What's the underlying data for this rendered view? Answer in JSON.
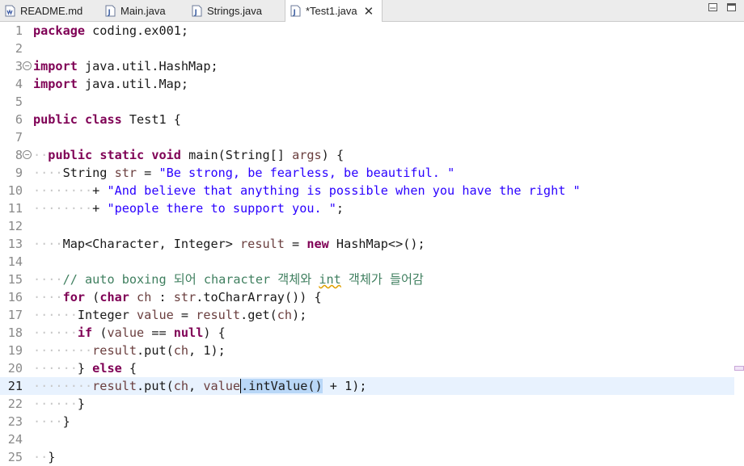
{
  "tabs": [
    {
      "label": "README.md",
      "icon": "markdown-file-icon",
      "active": false
    },
    {
      "label": "Main.java",
      "icon": "java-file-icon",
      "active": false
    },
    {
      "label": "Strings.java",
      "icon": "java-file-icon",
      "active": false
    },
    {
      "label": "*Test1.java",
      "icon": "java-file-icon",
      "active": true
    }
  ],
  "window_controls": [
    "minimize-icon",
    "maximize-icon"
  ],
  "editor": {
    "current_line": 21,
    "lines": [
      {
        "n": "1"
      },
      {
        "n": "2"
      },
      {
        "n": "3"
      },
      {
        "n": "4"
      },
      {
        "n": "5"
      },
      {
        "n": "6"
      },
      {
        "n": "7"
      },
      {
        "n": "8"
      },
      {
        "n": "9"
      },
      {
        "n": "10"
      },
      {
        "n": "11"
      },
      {
        "n": "12"
      },
      {
        "n": "13"
      },
      {
        "n": "14"
      },
      {
        "n": "15"
      },
      {
        "n": "16"
      },
      {
        "n": "17"
      },
      {
        "n": "18"
      },
      {
        "n": "19"
      },
      {
        "n": "20"
      },
      {
        "n": "21"
      },
      {
        "n": "22"
      },
      {
        "n": "23"
      },
      {
        "n": "24"
      },
      {
        "n": "25"
      }
    ],
    "t": {
      "l1a": "package",
      "l1b": " coding.ex001;",
      "l3a": "import",
      "l3b": " java.util.HashMap;",
      "l4a": "import",
      "l4b": " java.util.Map;",
      "l6a": "public",
      "l6b": "class",
      "l6c": " Test1 {",
      "l8a": "public",
      "l8b": "static",
      "l8c": "void",
      "l8d": " main(String[] ",
      "l8e": "args",
      "l8f": ") {",
      "l9a": "String ",
      "l9b": "str",
      "l9c": " = ",
      "l9d": "\"Be strong, be fearless, be beautiful. \"",
      "l10a": "+ ",
      "l10b": "\"And believe that anything is possible when you have the right \"",
      "l11a": "+ ",
      "l11b": "\"people there to support you. \"",
      "l11c": ";",
      "l13a": "Map<Character, Integer> ",
      "l13b": "result",
      "l13c": " = ",
      "l13d": "new",
      "l13e": " HashMap<>();",
      "l15a": "// auto boxing 되어 character 객체와 ",
      "l15b": "int",
      "l15c": " 객체가 들어감",
      "l16a": "for",
      "l16b": " (",
      "l16c": "char",
      "l16d": " ",
      "l16e": "ch",
      "l16f": " : ",
      "l16g": "str",
      "l16h": ".toCharArray()) {",
      "l17a": "Integer ",
      "l17b": "value",
      "l17c": " = ",
      "l17d": "result",
      "l17e": ".get(",
      "l17f": "ch",
      "l17g": ");",
      "l18a": "if",
      "l18b": " (",
      "l18c": "value",
      "l18d": " == ",
      "l18e": "null",
      "l18f": ") {",
      "l19a": "result",
      "l19b": ".put(",
      "l19c": "ch",
      "l19d": ", 1);",
      "l20a": "} ",
      "l20b": "else",
      "l20c": " {",
      "l21a": "result",
      "l21b": ".put(",
      "l21c": "ch",
      "l21d": ", ",
      "l21e": "value",
      "l21f": ".intValue()",
      "l21g": " + 1);",
      "l22a": "}",
      "l23a": "}",
      "l25a": "}"
    }
  }
}
